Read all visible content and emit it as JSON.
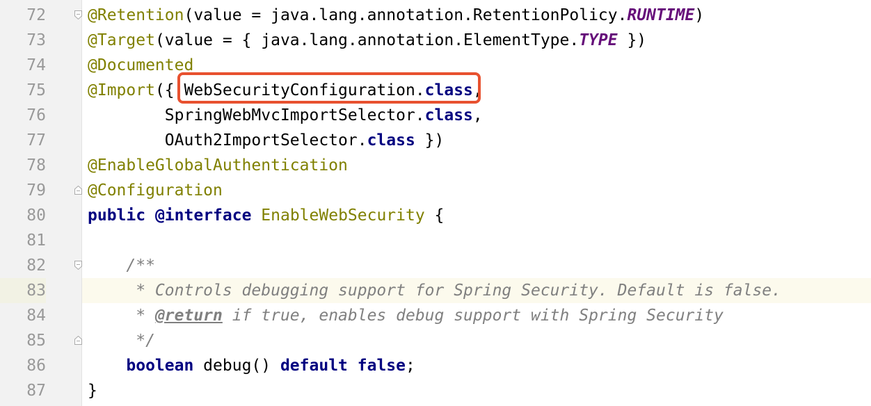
{
  "editor": {
    "highlight_color": "#e8512f",
    "current_line": "83",
    "lines": [
      {
        "num": "72",
        "fold": "fold-start-icon",
        "tokens": [
          {
            "t": "@Retention",
            "c": "annot"
          },
          {
            "t": "(value = java.lang.annotation.RetentionPolicy.",
            "c": ""
          },
          {
            "t": "RUNTIME",
            "c": "const"
          },
          {
            "t": ")",
            "c": ""
          }
        ]
      },
      {
        "num": "73",
        "tokens": [
          {
            "t": "@Target",
            "c": "annot"
          },
          {
            "t": "(value = { java.lang.annotation.ElementType.",
            "c": ""
          },
          {
            "t": "TYPE",
            "c": "const"
          },
          {
            "t": " })",
            "c": ""
          }
        ]
      },
      {
        "num": "74",
        "tokens": [
          {
            "t": "@Documented",
            "c": "annot"
          }
        ]
      },
      {
        "num": "75",
        "tokens": [
          {
            "t": "@Import",
            "c": "annot"
          },
          {
            "t": "({ ",
            "c": ""
          },
          {
            "t": "WebSecurityConfiguration.",
            "c": ""
          },
          {
            "t": "class",
            "c": "kw"
          },
          {
            "t": ",",
            "c": ""
          }
        ]
      },
      {
        "num": "76",
        "tokens": [
          {
            "t": "        SpringWebMvcImportSelector.",
            "c": ""
          },
          {
            "t": "class",
            "c": "kw"
          },
          {
            "t": ",",
            "c": ""
          }
        ]
      },
      {
        "num": "77",
        "tokens": [
          {
            "t": "        OAuth2ImportSelector.",
            "c": ""
          },
          {
            "t": "class",
            "c": "kw"
          },
          {
            "t": " })",
            "c": ""
          }
        ]
      },
      {
        "num": "78",
        "tokens": [
          {
            "t": "@EnableGlobalAuthentication",
            "c": "annot"
          }
        ]
      },
      {
        "num": "79",
        "fold": "fold-end-icon",
        "tokens": [
          {
            "t": "@Configuration",
            "c": "annot"
          }
        ]
      },
      {
        "num": "80",
        "tokens": [
          {
            "t": "public",
            "c": "kw"
          },
          {
            "t": " ",
            "c": ""
          },
          {
            "t": "@interface",
            "c": "kw"
          },
          {
            "t": " ",
            "c": ""
          },
          {
            "t": "EnableWebSecurity",
            "c": "annot"
          },
          {
            "t": " {",
            "c": ""
          }
        ]
      },
      {
        "num": "81",
        "tokens": []
      },
      {
        "num": "82",
        "fold": "fold-start-icon",
        "tokens": [
          {
            "t": "    /**",
            "c": "cmt"
          }
        ]
      },
      {
        "num": "83",
        "tokens": [
          {
            "t": "     * Controls debugging support for Spring Security. Default is false.",
            "c": "cmt"
          }
        ]
      },
      {
        "num": "84",
        "tokens": [
          {
            "t": "     * ",
            "c": "cmt"
          },
          {
            "t": "@return",
            "c": "tag"
          },
          {
            "t": " if true, enables debug support with Spring Security",
            "c": "cmt"
          }
        ]
      },
      {
        "num": "85",
        "fold": "fold-end-icon",
        "tokens": [
          {
            "t": "     */",
            "c": "cmt"
          }
        ]
      },
      {
        "num": "86",
        "tokens": [
          {
            "t": "    ",
            "c": ""
          },
          {
            "t": "boolean",
            "c": "kw"
          },
          {
            "t": " debug() ",
            "c": ""
          },
          {
            "t": "default",
            "c": "kw"
          },
          {
            "t": " ",
            "c": ""
          },
          {
            "t": "false",
            "c": "kw"
          },
          {
            "t": ";",
            "c": ""
          }
        ]
      },
      {
        "num": "87",
        "tokens": [
          {
            "t": "}",
            "c": ""
          }
        ]
      }
    ]
  }
}
